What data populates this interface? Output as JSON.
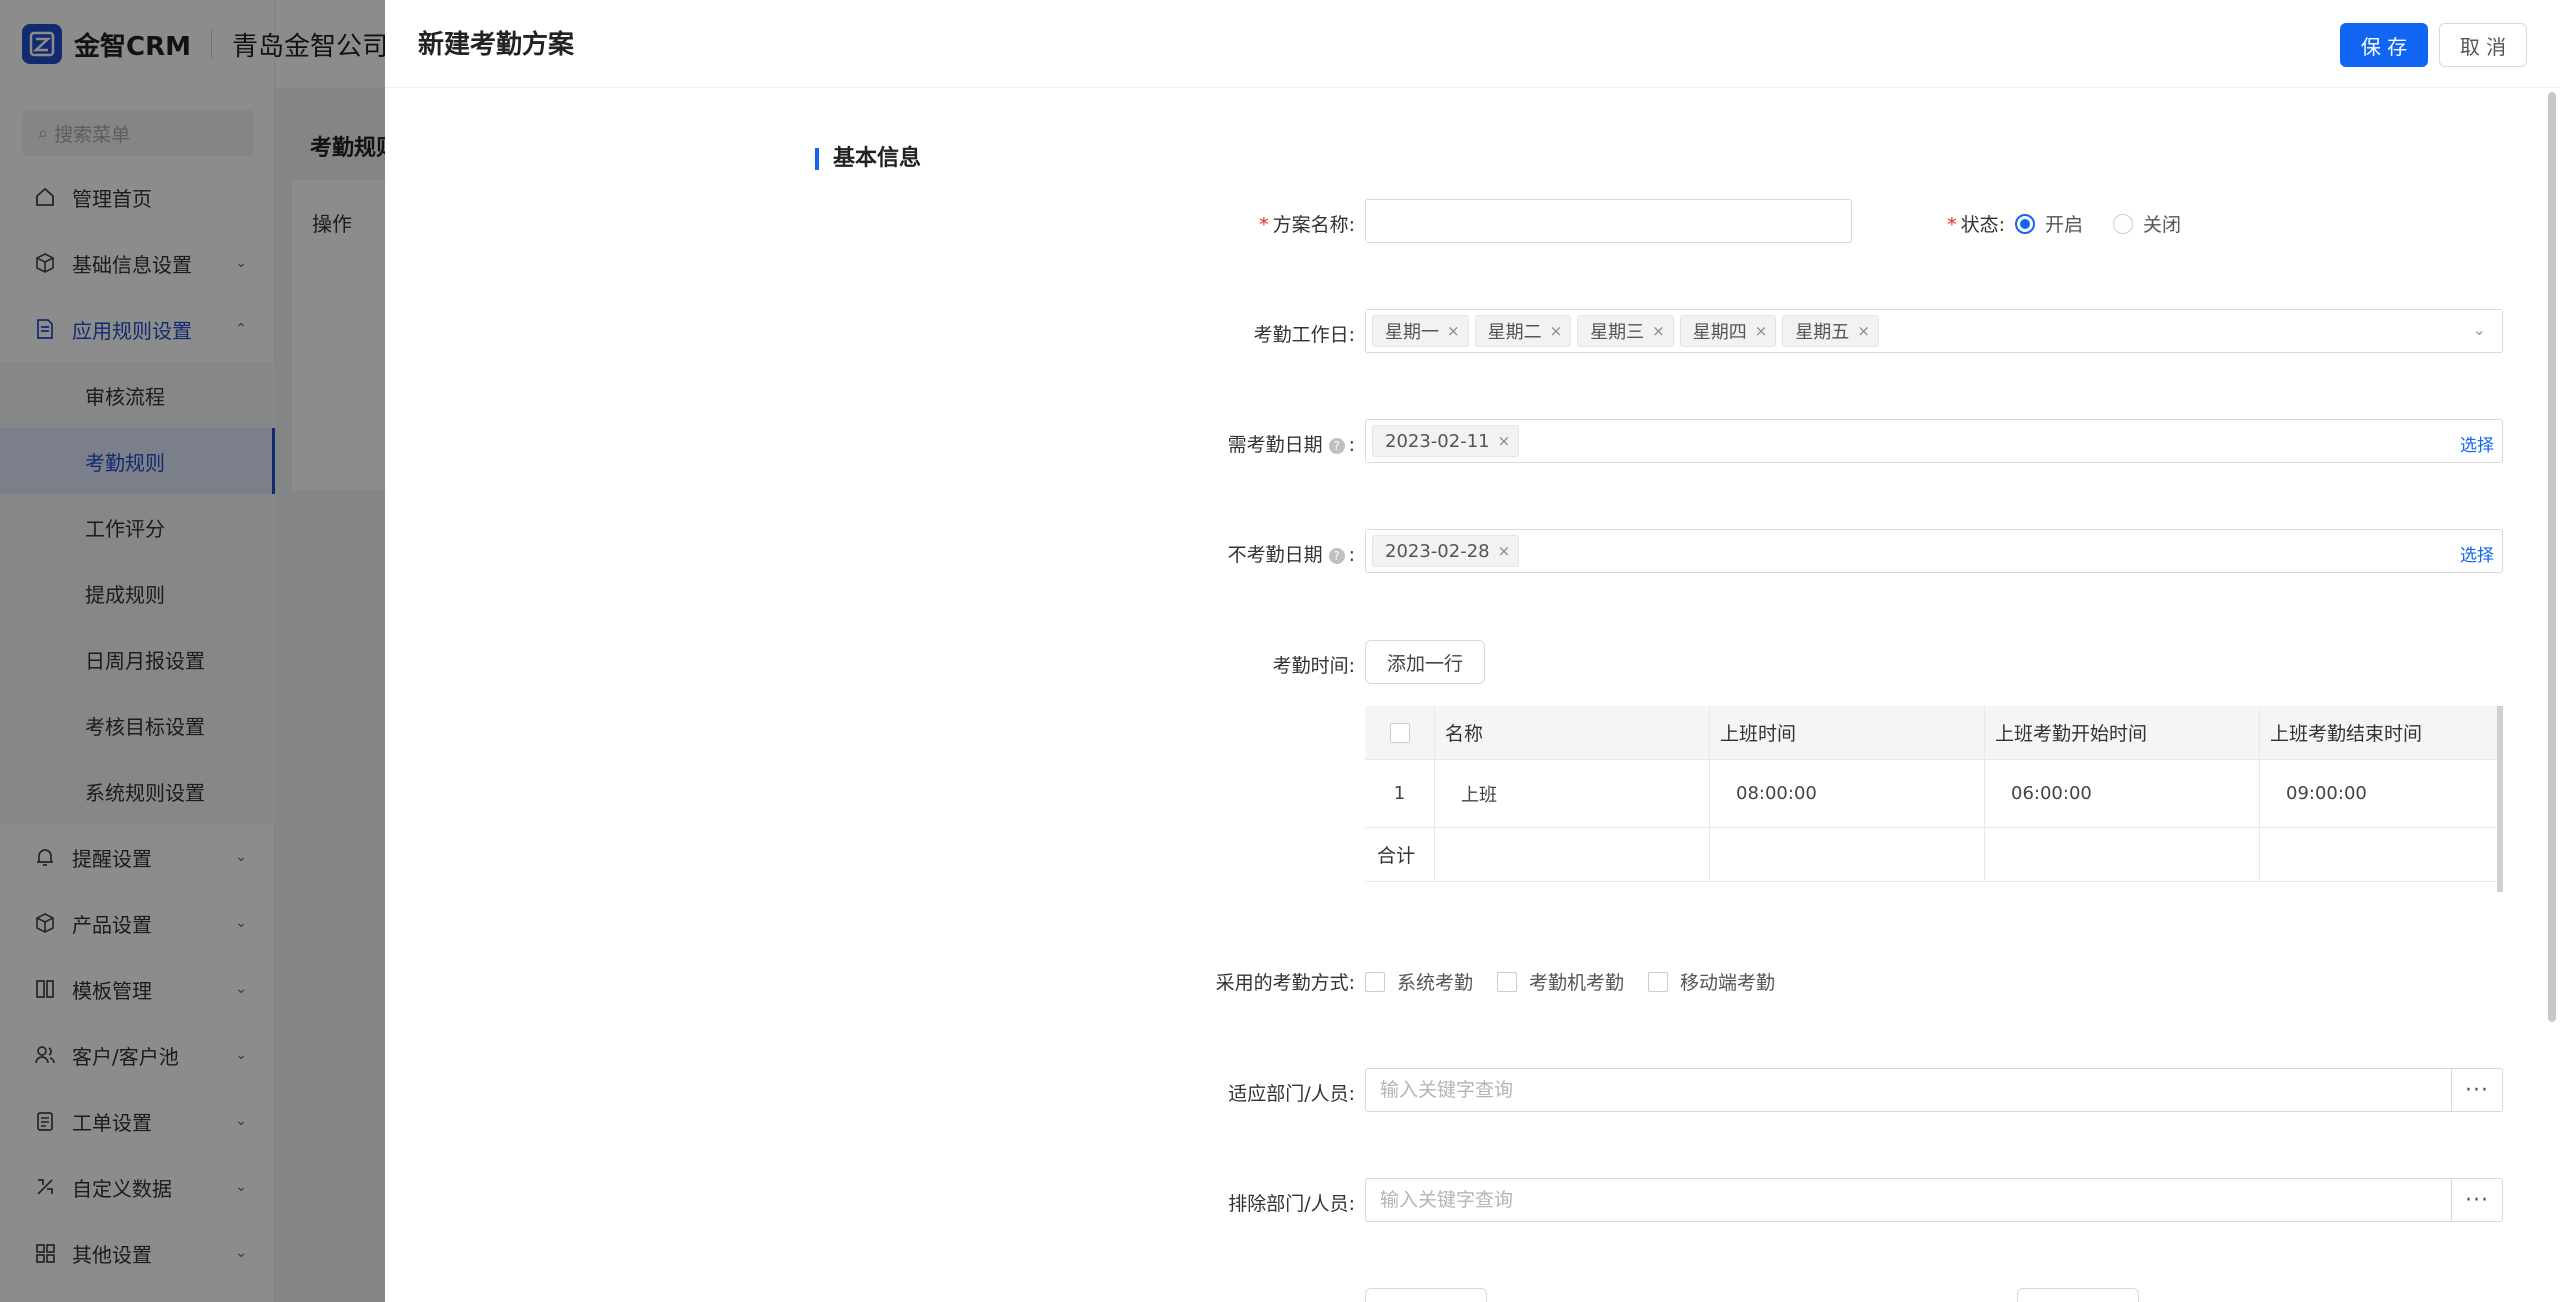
{
  "app": {
    "brand": "金智CRM",
    "company": "青岛金智公司",
    "search_placeholder": "搜索菜单",
    "colors": {
      "primary": "#1165f2",
      "brand": "#1f4fc9",
      "required": "#f5222d"
    }
  },
  "menu": {
    "items": [
      {
        "label": "管理首页",
        "icon": "home-icon"
      },
      {
        "label": "基础信息设置",
        "icon": "cube-icon"
      },
      {
        "label": "应用规则设置",
        "icon": "document-icon"
      },
      {
        "label": "提醒设置",
        "icon": "bell-icon"
      },
      {
        "label": "产品设置",
        "icon": "box-icon"
      },
      {
        "label": "模板管理",
        "icon": "layout-icon"
      },
      {
        "label": "客户/客户池",
        "icon": "users-icon"
      },
      {
        "label": "工单设置",
        "icon": "ticket-icon"
      },
      {
        "label": "自定义数据",
        "icon": "custom-icon"
      },
      {
        "label": "其他设置",
        "icon": "grid-icon"
      }
    ],
    "sub_items": [
      "审核流程",
      "考勤规则",
      "工作评分",
      "提成规则",
      "日周月报设置",
      "考核目标设置",
      "系统规则设置"
    ]
  },
  "background": {
    "page_title": "考勤规则",
    "column_op": "操作"
  },
  "drawer": {
    "title": "新建考勤方案",
    "save_label": "保 存",
    "cancel_label": "取 消",
    "section_title": "基本信息",
    "fields": {
      "name_label": "方案名称:",
      "name_value": "",
      "status_label": "状态:",
      "status_on": "开启",
      "status_off": "关闭",
      "status_selected": "开启",
      "workdays_label": "考勤工作日:",
      "workdays": [
        "星期一",
        "星期二",
        "星期三",
        "星期四",
        "星期五"
      ],
      "need_dates_label": "需考勤日期",
      "need_dates": [
        "2023-02-11"
      ],
      "no_dates_label": "不考勤日期",
      "no_dates": [
        "2023-02-28"
      ],
      "pick_label": "选择",
      "time_label": "考勤时间:",
      "add_row_label": "添加一行",
      "methods_label": "采用的考勤方式:",
      "methods": [
        "系统考勤",
        "考勤机考勤",
        "移动端考勤"
      ],
      "dept_label": "适应部门/人员:",
      "dept_placeholder": "输入关键字查询",
      "exclude_label": "排除部门/人员:",
      "exclude_placeholder": "输入关键字查询",
      "dots": "···"
    },
    "table": {
      "headers": [
        "名称",
        "上班时间",
        "上班考勤开始时间",
        "上班考勤结束时间"
      ],
      "rows": [
        {
          "index": "1",
          "name": "上班",
          "start": "08:00:00",
          "check_start": "06:00:00",
          "check_end": "09:00:00"
        }
      ],
      "summary_label": "合计"
    }
  }
}
